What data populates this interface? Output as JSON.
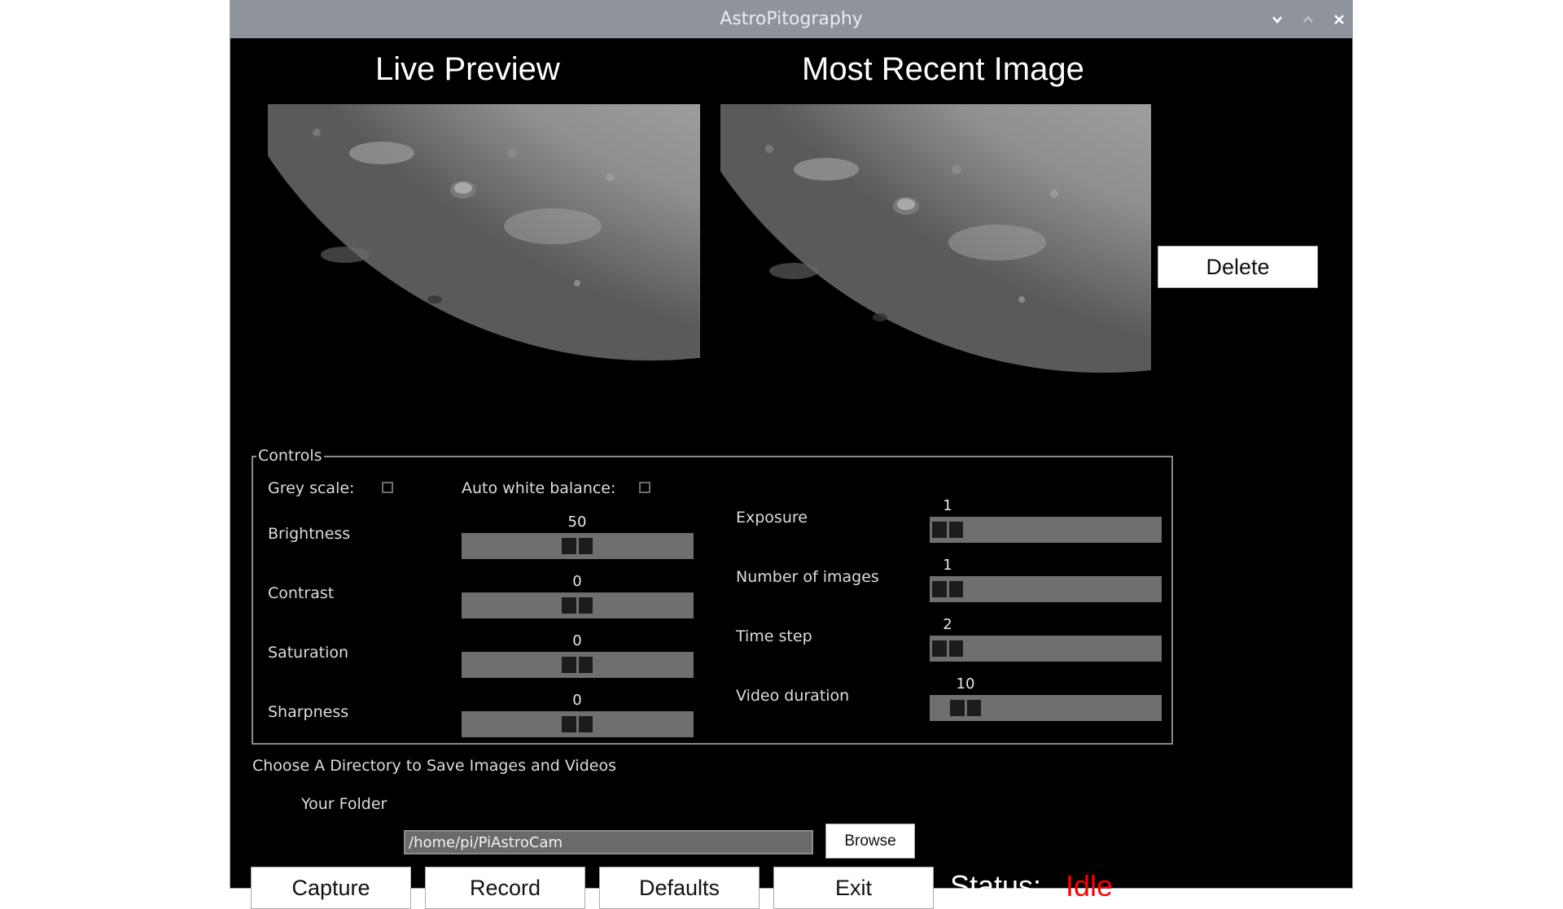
{
  "window": {
    "title": "AstroPitography",
    "titlebar_buttons": [
      "chevron-down-icon",
      "chevron-up-icon",
      "close-icon"
    ]
  },
  "preview": {
    "live_heading": "Live Preview",
    "recent_heading": "Most Recent Image",
    "delete_label": "Delete"
  },
  "controls": {
    "legend": "Controls",
    "grey_scale": {
      "label": "Grey scale:",
      "checked": false
    },
    "auto_white_balance": {
      "label": "Auto white balance:",
      "checked": false
    },
    "left_sliders": [
      {
        "label": "Brightness",
        "value": "50"
      },
      {
        "label": "Contrast",
        "value": "0"
      },
      {
        "label": "Saturation",
        "value": "0"
      },
      {
        "label": "Sharpness",
        "value": "0"
      }
    ],
    "right_sliders": [
      {
        "label": "Exposure",
        "value": "1"
      },
      {
        "label": "Number of images",
        "value": "1"
      },
      {
        "label": "Time step",
        "value": "2"
      },
      {
        "label": "Video duration",
        "value": "10"
      }
    ]
  },
  "directory": {
    "prompt": "Choose A Directory to Save Images and Videos",
    "folder_label": "Your Folder",
    "folder_value": "/home/pi/PiAstroCam",
    "browse_label": "Browse"
  },
  "actions": {
    "capture_label": "Capture",
    "record_label": "Record",
    "defaults_label": "Defaults",
    "exit_label": "Exit"
  },
  "status": {
    "label": "Status:",
    "value": "Idle",
    "value_color": "#ff0000"
  }
}
